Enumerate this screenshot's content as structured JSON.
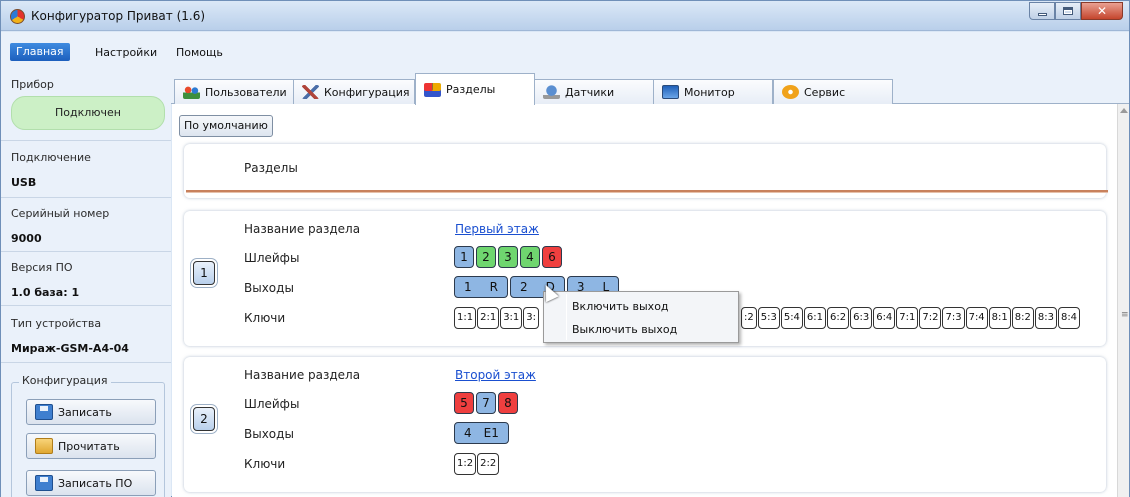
{
  "window": {
    "title": "Конфигуратор Приват (1.6)"
  },
  "menu": {
    "main": "Главная",
    "settings": "Настройки",
    "help": "Помощь"
  },
  "sidebar": {
    "device_group": "Прибор",
    "status": "Подключен",
    "connection_label": "Подключение",
    "connection_value": "USB",
    "serial_label": "Серийный номер",
    "serial_value": "9000",
    "firmware_label": "Версия ПО",
    "firmware_value": "1.0 база: 1",
    "device_type_label": "Тип устройства",
    "device_type_value": "Мираж-GSM-A4-04",
    "config_group": "Конфигурация",
    "buttons": {
      "write": "Записать",
      "read": "Прочитать",
      "write_fw": "Записать ПО"
    }
  },
  "tabs": [
    {
      "label": "Пользователи",
      "icon": "users-icon"
    },
    {
      "label": "Конфигурация",
      "icon": "tools-icon"
    },
    {
      "label": "Разделы",
      "icon": "sections-icon",
      "active": true
    },
    {
      "label": "Датчики",
      "icon": "sensor-icon"
    },
    {
      "label": "Монитор",
      "icon": "monitor-icon"
    },
    {
      "label": "Сервис",
      "icon": "service-icon"
    }
  ],
  "main": {
    "default_button": "По умолчанию",
    "header_title": "Разделы",
    "labels": {
      "name": "Название раздела",
      "loops": "Шлейфы",
      "outputs": "Выходы",
      "keys": "Ключи"
    },
    "sections": [
      {
        "number": "1",
        "name": "Первый этаж",
        "loops": [
          {
            "n": "1",
            "state": "blue"
          },
          {
            "n": "2",
            "state": "green"
          },
          {
            "n": "3",
            "state": "green"
          },
          {
            "n": "4",
            "state": "green"
          },
          {
            "n": "6",
            "state": "red"
          }
        ],
        "outputs": [
          [
            "1",
            "R"
          ],
          [
            "2",
            "D"
          ],
          [
            "3",
            "L"
          ]
        ],
        "keys_left": [
          "1:1",
          "2:1",
          "3:1",
          "3:"
        ],
        "keys_right": [
          ":2",
          "5:3",
          "5:4",
          "6:1",
          "6:2",
          "6:3",
          "6:4",
          "7:1",
          "7:2",
          "7:3",
          "7:4",
          "8:1",
          "8:2",
          "8:3",
          "8:4"
        ]
      },
      {
        "number": "2",
        "name": "Второй этаж",
        "loops": [
          {
            "n": "5",
            "state": "red"
          },
          {
            "n": "7",
            "state": "blue"
          },
          {
            "n": "8",
            "state": "red"
          }
        ],
        "outputs": [
          [
            "4",
            "E1"
          ]
        ],
        "keys_left": [
          "1:2",
          "2:2"
        ]
      }
    ]
  },
  "context_menu": {
    "enable": "Включить выход",
    "disable": "Выключить выход"
  },
  "colors": {
    "loop_blue": "#8eb6e3",
    "loop_green": "#6fd66f",
    "loop_red": "#ef3f3f",
    "link": "#1a4fd0",
    "status_ok": "#ccf0c6"
  }
}
